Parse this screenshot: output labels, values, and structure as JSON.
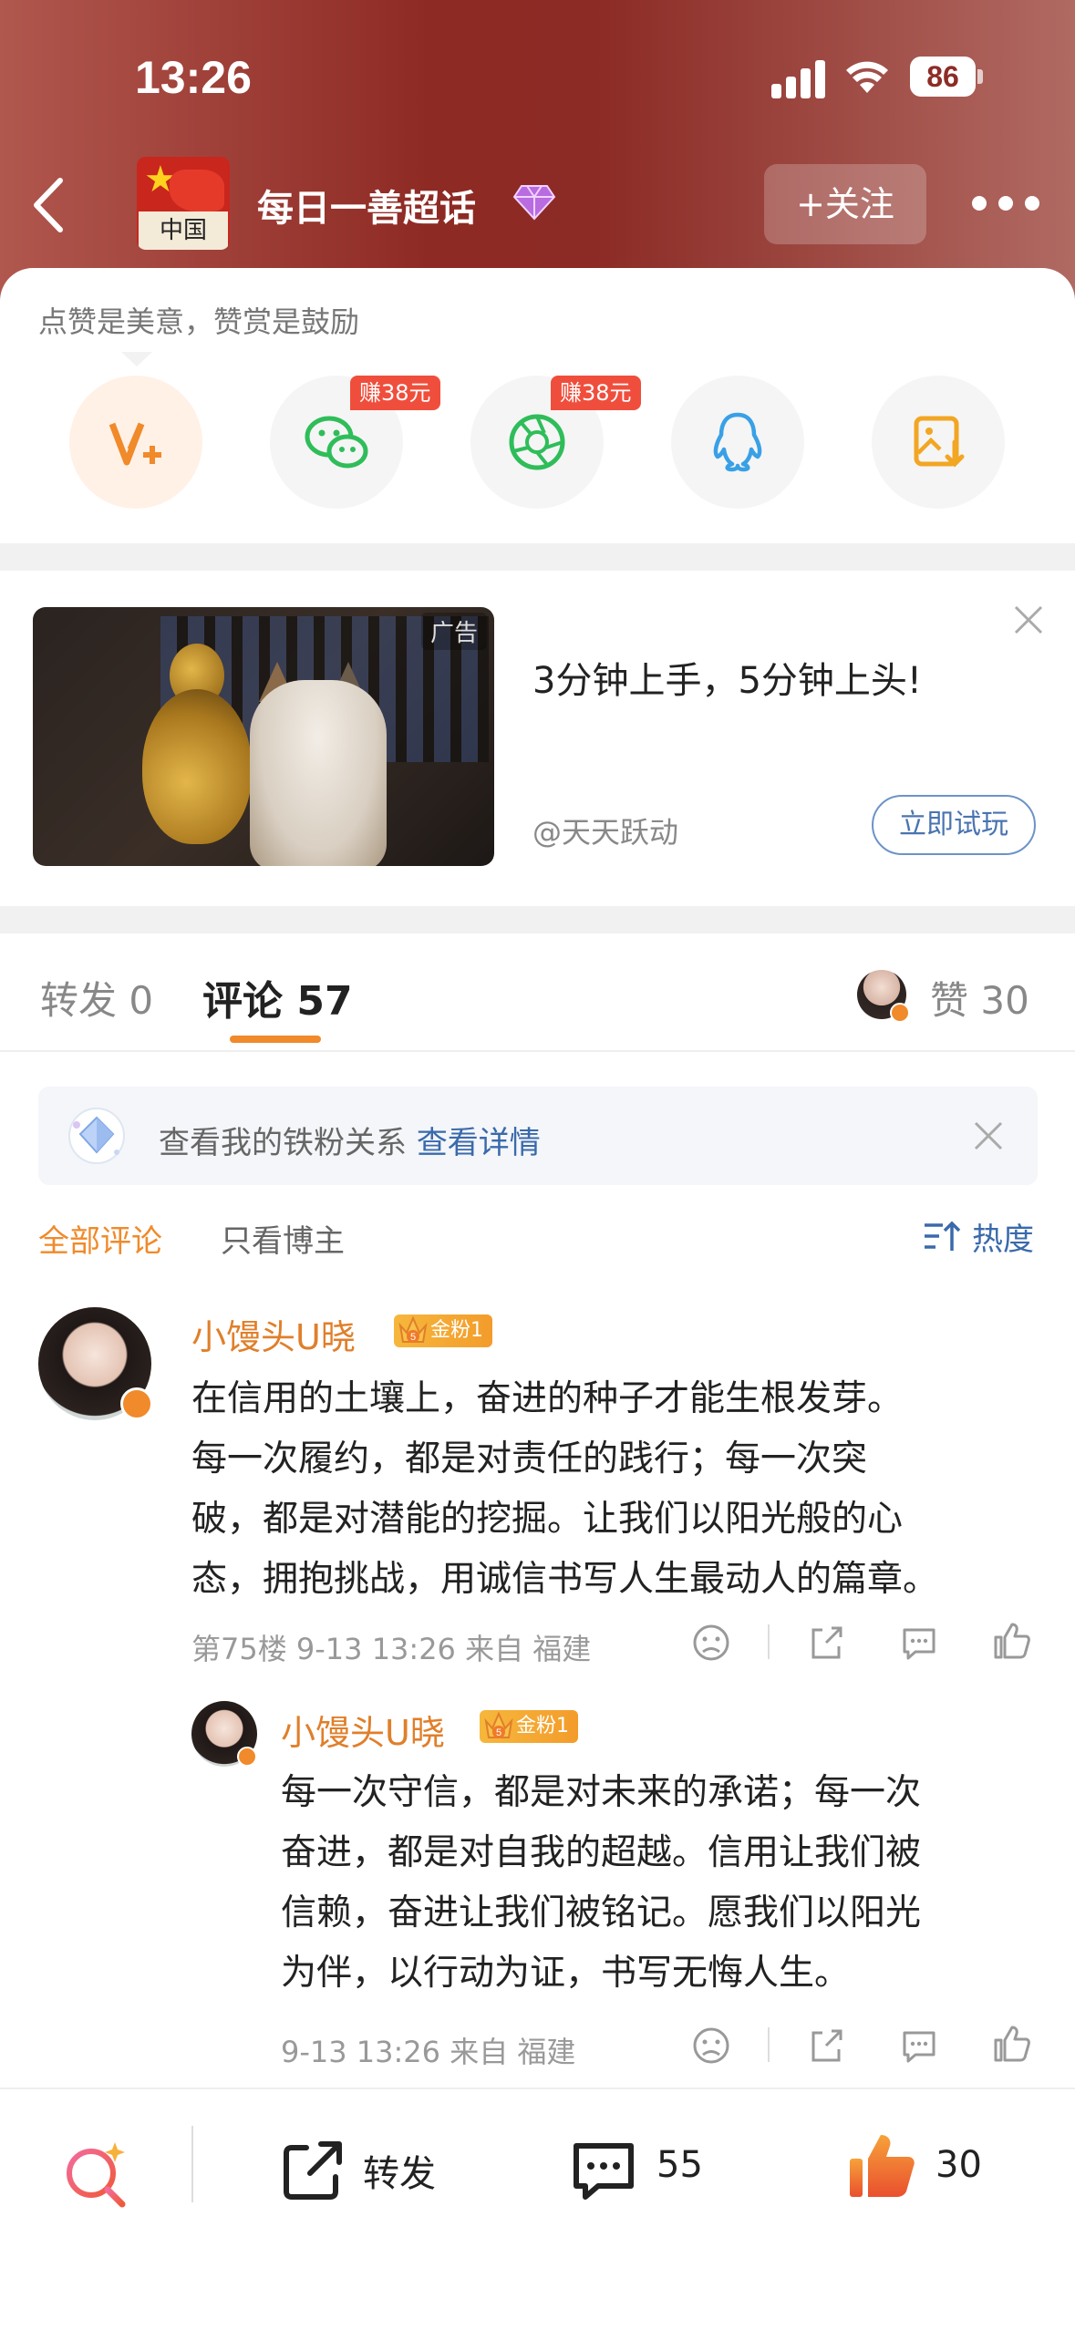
{
  "status_bar": {
    "time": "13:26",
    "battery": "86"
  },
  "header": {
    "avatar_text": "中国",
    "topic_title": "每日一善超话",
    "follow_label": "+关注"
  },
  "share_panel": {
    "tip": "点赞是美意，赞赏是鼓励",
    "wechat_badge": "赚38元",
    "moments_badge": "赚38元"
  },
  "ad": {
    "label": "广告",
    "headline": "3分钟上手，5分钟上头!",
    "source": "@天天跃动",
    "cta": "立即试玩"
  },
  "tabs": {
    "repost_label": "转发",
    "repost_count": "0",
    "comments_label": "评论",
    "comments_count": "57",
    "likes_label": "赞",
    "likes_count": "30"
  },
  "fan_banner": {
    "text": "查看我的铁粉关系",
    "link": "查看详情"
  },
  "filter": {
    "all": "全部评论",
    "owner_only": "只看博主",
    "sort": "热度"
  },
  "comments": [
    {
      "username": "小馒头U晓",
      "badge": "金粉1",
      "badge_level": "5",
      "lines": [
        "在信用的土壤上，奋进的种子才能生根发芽。",
        "每一次履约，都是对责任的践行；每一次突",
        "破，都是对潜能的挖掘。让我们以阳光般的心",
        "态，拥抱挑战，用诚信书写人生最动人的篇章。"
      ],
      "meta": "第75楼 9-13 13:26 来自 福建"
    },
    {
      "username": "小馒头U晓",
      "badge": "金粉1",
      "badge_level": "5",
      "lines": [
        "每一次守信，都是对未来的承诺；每一次",
        "奋进，都是对自我的超越。信用让我们被",
        "信赖，奋进让我们被铭记。愿我们以阳光",
        "为伴，以行动为证，书写无悔人生。"
      ],
      "meta": "9-13 13:26 来自 福建"
    }
  ],
  "bottom_bar": {
    "repost_label": "转发",
    "comment_count": "55",
    "like_count": "30"
  },
  "colors": {
    "accent": "#f08a2a",
    "link": "#3a6aab",
    "header_bg": "#8e2a24"
  }
}
